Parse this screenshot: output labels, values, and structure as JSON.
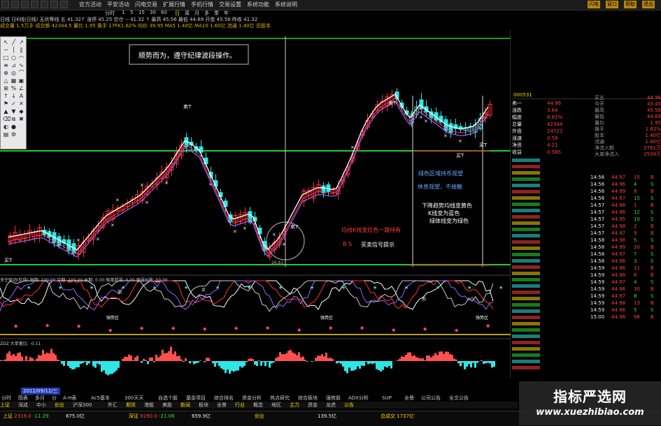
{
  "menu": {
    "items": [
      "官方活动",
      "平安活动",
      "闪电交易",
      "扩展行情",
      "手机行情",
      "交易设置",
      "系统功能",
      "系统说明"
    ],
    "periods": [
      "分时",
      "1",
      "5",
      "15",
      "30",
      "60",
      "日",
      "周",
      "月",
      "多",
      "季",
      "年"
    ],
    "right_buttons": [
      "闪电",
      "窗口",
      "帮助",
      "退出"
    ]
  },
  "info": {
    "line1": "日线 日K线(日线)  无优等线 五  41.32↑ 涨停 45.25  空仓 --  41.32 ↑  最高 45.56  最低 44.69  开盘 45.56  昨收 41.32",
    "line2": "成交量 1.5万手  成交额 42344.5 量比 1.95  换手 17FK1.62%  均价 39.95  MA5 1.40亿  MA10 1.60亿  流通 1.40亿  总股本"
  },
  "chart": {
    "annotation_main": "顺势而为，遵守纪律波段操作。",
    "annotation_green_zone": "绿色区域持币观望",
    "annotation_wait": "休息观望，不接触",
    "annotation_red_line": "均线K线变红色一路持有",
    "annotation_signal": "买卖信号提示",
    "annotation_signal_prefix": "B  S",
    "annotation_down1": "下降趋势均线变黄色",
    "annotation_down2": "K线变为蓝色",
    "annotation_down3": "绿体线变为绿色",
    "label_sell": "卖T",
    "label_buy": "买T",
    "price_low": "26.81",
    "price_high": "45.56",
    "indicator1_header": "多空驱动(反指)  短期: 100.00  中期: 100.00  长期: 0.00  极度超涨: 0.00  强弱分界: 50.00",
    "indicator2_header": "ZDZ 大单量比: -0.11",
    "marker_buy": "买",
    "marker_add": "加",
    "marker_strong": "强势区"
  },
  "right_panel": {
    "header": "买五",
    "code": "000531",
    "quotes": [
      {
        "label": "买五",
        "value": "44.96"
      },
      {
        "label": "今开",
        "value": "43.45"
      },
      {
        "label": "最高",
        "value": "45.56"
      },
      {
        "label": "最低",
        "value": "44.69"
      },
      {
        "label": "量比",
        "value": "1.95"
      },
      {
        "label": "换手",
        "value": "1.62%"
      },
      {
        "label": "股本",
        "value": "1.40亿"
      },
      {
        "label": "流通",
        "value": "1.40亿"
      },
      {
        "label": "净流入额",
        "value": "2781万"
      },
      {
        "label": "大单净流入",
        "value": "2509万"
      }
    ],
    "stats": [
      {
        "label": "卖一",
        "value": "44.96"
      },
      {
        "label": "涨跌",
        "value": "3.64"
      },
      {
        "label": "幅度",
        "value": "8.81%"
      },
      {
        "label": "总量",
        "value": "42344"
      },
      {
        "label": "外盘",
        "value": "24723"
      },
      {
        "label": "涨速",
        "value": "0.58"
      },
      {
        "label": "净资",
        "value": "4.21"
      },
      {
        "label": "收益",
        "value": "0.585"
      }
    ],
    "trades": [
      {
        "t": "14:56",
        "p": "44.97",
        "v": "15",
        "s": "B"
      },
      {
        "t": "14:56",
        "p": "44.96",
        "v": "4",
        "s": "S"
      },
      {
        "t": "14:56",
        "p": "44.99",
        "v": "8",
        "s": "B"
      },
      {
        "t": "14:56",
        "p": "44.97",
        "v": "15",
        "s": "S"
      },
      {
        "t": "14:57",
        "p": "44.98",
        "v": "1",
        "s": "B"
      },
      {
        "t": "14:57",
        "p": "44.96",
        "v": "12",
        "s": "S"
      },
      {
        "t": "14:57",
        "p": "44.95",
        "v": "10",
        "s": "S"
      },
      {
        "t": "14:57",
        "p": "44.98",
        "v": "2",
        "s": "B"
      },
      {
        "t": "14:57",
        "p": "44.97",
        "v": "9",
        "s": "B"
      },
      {
        "t": "14:58",
        "p": "44.98",
        "v": "5",
        "s": "S"
      },
      {
        "t": "14:58",
        "p": "44.99",
        "v": "20",
        "s": "B"
      },
      {
        "t": "14:58",
        "p": "44.97",
        "v": "7",
        "s": "S"
      },
      {
        "t": "14:58",
        "p": "44.96",
        "v": "3",
        "s": "S"
      },
      {
        "t": "14:59",
        "p": "44.96",
        "v": "11",
        "s": "B"
      },
      {
        "t": "14:59",
        "p": "44.98",
        "v": "6",
        "s": "B"
      },
      {
        "t": "14:59",
        "p": "44.97",
        "v": "4",
        "s": "S"
      },
      {
        "t": "14:59",
        "p": "44.96",
        "v": "30",
        "s": "B"
      },
      {
        "t": "14:59",
        "p": "44.97",
        "v": "8",
        "s": "S"
      },
      {
        "t": "14:59",
        "p": "44.98",
        "v": "13",
        "s": "B"
      },
      {
        "t": "14:59",
        "p": "44.96",
        "v": "5",
        "s": "S"
      },
      {
        "t": "15:00",
        "p": "44.96",
        "v": "96",
        "s": "B"
      }
    ]
  },
  "bottom": {
    "date_label": "2012/09/12/三",
    "tabs": [
      "分时",
      "图表",
      "多月",
      "分",
      "A-H表",
      "Ac5基本",
      "300天天",
      "自选个股",
      "基金项目",
      "综合排名",
      "资金分析",
      "热点研究",
      "综合板块",
      "强势股",
      "ADX分析",
      "SUP",
      "全景",
      "公司公告",
      "全文公告"
    ],
    "sectors": [
      "上证",
      "深成",
      "中小",
      "创业",
      "沪深300",
      "外汇",
      "期货",
      "港股",
      "美股",
      "新闻",
      "板块",
      "全景",
      "行业",
      "概念",
      "地区",
      "主力",
      "资金",
      "龙虎",
      "公告"
    ],
    "status": [
      {
        "label": "上证",
        "value": "2316.0",
        "chg": "-11.29",
        "color": "red"
      },
      {
        "label": "",
        "value": "875.0亿",
        "chg": "",
        "color": "white"
      },
      {
        "label": "深证",
        "value": "9190.0",
        "chg": "-21.06",
        "color": "red"
      },
      {
        "label": "",
        "value": "659.9亿",
        "chg": "",
        "color": "white"
      },
      {
        "label": "创业",
        "value": "",
        "chg": "",
        "color": "white"
      },
      {
        "label": "",
        "value": "139.5亿",
        "chg": "",
        "color": "white"
      },
      {
        "label": "总成交",
        "value": "1737亿",
        "chg": "",
        "color": "yellow"
      }
    ]
  },
  "watermark": {
    "title": "指标严选网",
    "url": "www.xuezhibiao.com"
  },
  "colors": {
    "up": "#ff3030",
    "down": "#2ee6e6",
    "ma": "#ffffff",
    "ma2": "#b070ff",
    "green_line": "#28c828",
    "red_line": "#e02020",
    "yellow": "#ffd400"
  }
}
